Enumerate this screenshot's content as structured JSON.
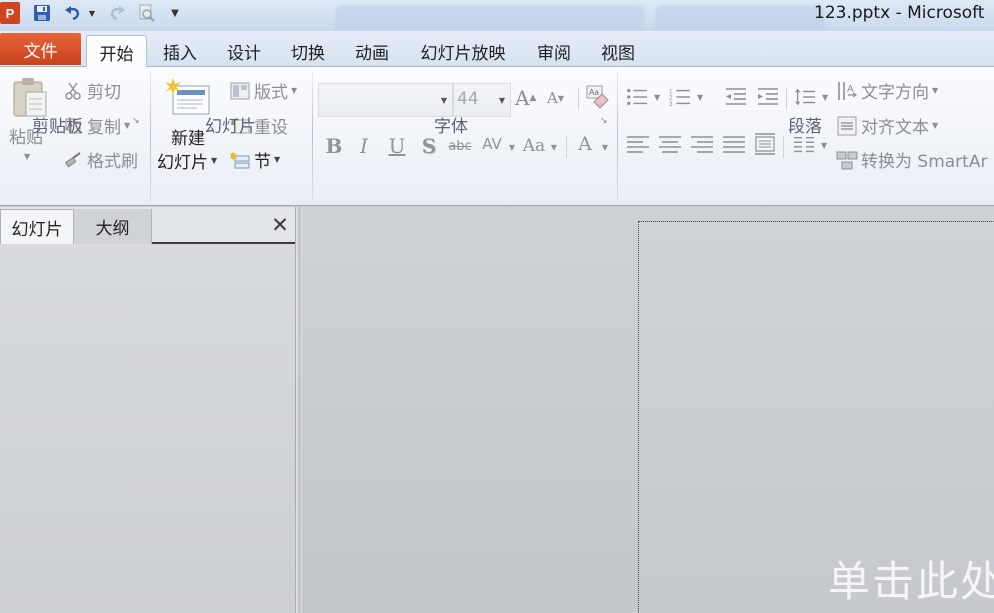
{
  "window": {
    "title": "123.pptx - Microsoft",
    "app_logo": "P",
    "accent": "#d04420"
  },
  "quick_access": [
    "save-icon",
    "undo-icon",
    "redo-icon",
    "print-preview-icon",
    "customize-arrow-icon"
  ],
  "ribbon_tabs": {
    "file": "文件",
    "tabs": [
      "开始",
      "插入",
      "设计",
      "切换",
      "动画",
      "幻灯片放映",
      "审阅",
      "视图"
    ],
    "active": "开始"
  },
  "ribbon": {
    "clipboard": {
      "paste": "粘贴",
      "cut": "剪切",
      "copy": "复制",
      "format_painter": "格式刷",
      "label": "剪贴板"
    },
    "slides": {
      "new_slide_line1": "新建",
      "new_slide_line2": "幻灯片",
      "layout": "版式",
      "reset": "重设",
      "section": "节",
      "label": "幻灯片"
    },
    "font": {
      "font_name": "",
      "font_size": "44",
      "bold": "B",
      "italic": "I",
      "underline": "U",
      "shadow": "S",
      "strikethrough": "abc",
      "spacing": "AV",
      "change_case": "Aa",
      "font_color": "A",
      "label": "字体"
    },
    "paragraph": {
      "text_direction": "文字方向",
      "align_text": "对齐文本",
      "convert_smartart": "转换为 SmartAr",
      "label": "段落"
    }
  },
  "pane": {
    "tab_slides": "幻灯片",
    "tab_outline": "大纲",
    "close": "✕"
  },
  "slide": {
    "placeholder_text": "单击此处"
  }
}
